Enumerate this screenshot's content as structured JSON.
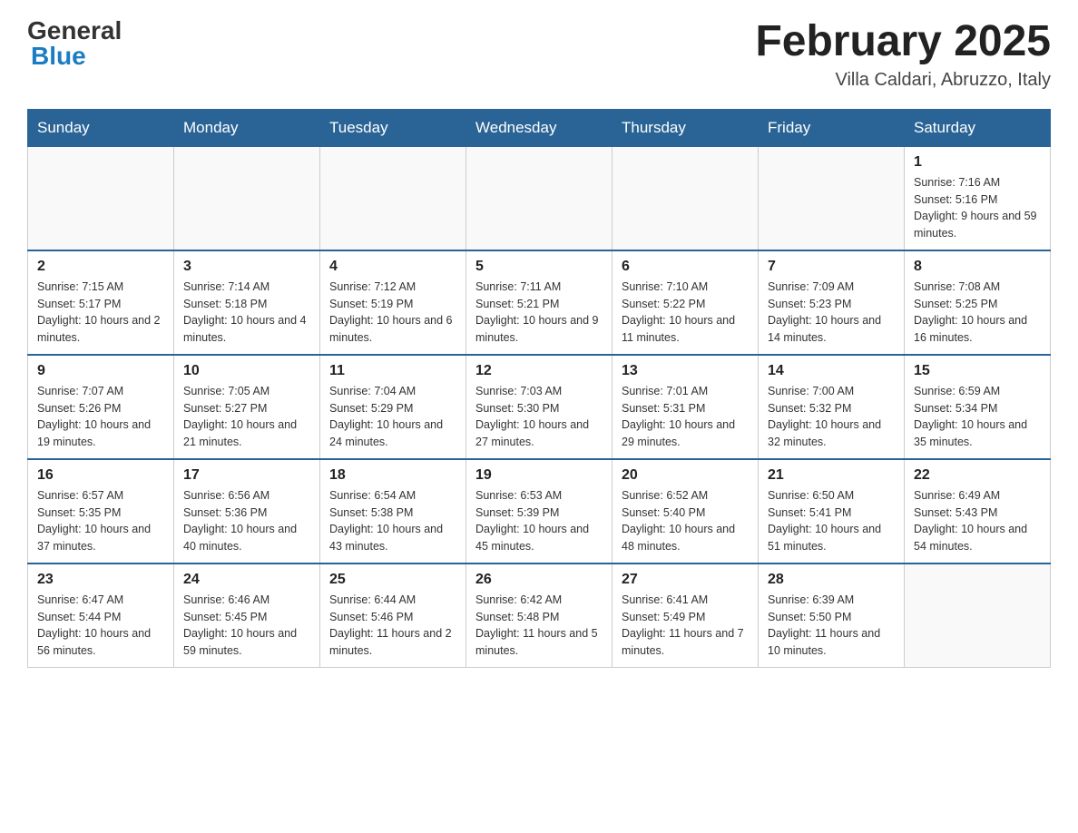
{
  "logo": {
    "general": "General",
    "blue": "Blue"
  },
  "title": "February 2025",
  "subtitle": "Villa Caldari, Abruzzo, Italy",
  "days_header": [
    "Sunday",
    "Monday",
    "Tuesday",
    "Wednesday",
    "Thursday",
    "Friday",
    "Saturday"
  ],
  "weeks": [
    [
      {
        "day": "",
        "info": ""
      },
      {
        "day": "",
        "info": ""
      },
      {
        "day": "",
        "info": ""
      },
      {
        "day": "",
        "info": ""
      },
      {
        "day": "",
        "info": ""
      },
      {
        "day": "",
        "info": ""
      },
      {
        "day": "1",
        "info": "Sunrise: 7:16 AM\nSunset: 5:16 PM\nDaylight: 9 hours and 59 minutes."
      }
    ],
    [
      {
        "day": "2",
        "info": "Sunrise: 7:15 AM\nSunset: 5:17 PM\nDaylight: 10 hours and 2 minutes."
      },
      {
        "day": "3",
        "info": "Sunrise: 7:14 AM\nSunset: 5:18 PM\nDaylight: 10 hours and 4 minutes."
      },
      {
        "day": "4",
        "info": "Sunrise: 7:12 AM\nSunset: 5:19 PM\nDaylight: 10 hours and 6 minutes."
      },
      {
        "day": "5",
        "info": "Sunrise: 7:11 AM\nSunset: 5:21 PM\nDaylight: 10 hours and 9 minutes."
      },
      {
        "day": "6",
        "info": "Sunrise: 7:10 AM\nSunset: 5:22 PM\nDaylight: 10 hours and 11 minutes."
      },
      {
        "day": "7",
        "info": "Sunrise: 7:09 AM\nSunset: 5:23 PM\nDaylight: 10 hours and 14 minutes."
      },
      {
        "day": "8",
        "info": "Sunrise: 7:08 AM\nSunset: 5:25 PM\nDaylight: 10 hours and 16 minutes."
      }
    ],
    [
      {
        "day": "9",
        "info": "Sunrise: 7:07 AM\nSunset: 5:26 PM\nDaylight: 10 hours and 19 minutes."
      },
      {
        "day": "10",
        "info": "Sunrise: 7:05 AM\nSunset: 5:27 PM\nDaylight: 10 hours and 21 minutes."
      },
      {
        "day": "11",
        "info": "Sunrise: 7:04 AM\nSunset: 5:29 PM\nDaylight: 10 hours and 24 minutes."
      },
      {
        "day": "12",
        "info": "Sunrise: 7:03 AM\nSunset: 5:30 PM\nDaylight: 10 hours and 27 minutes."
      },
      {
        "day": "13",
        "info": "Sunrise: 7:01 AM\nSunset: 5:31 PM\nDaylight: 10 hours and 29 minutes."
      },
      {
        "day": "14",
        "info": "Sunrise: 7:00 AM\nSunset: 5:32 PM\nDaylight: 10 hours and 32 minutes."
      },
      {
        "day": "15",
        "info": "Sunrise: 6:59 AM\nSunset: 5:34 PM\nDaylight: 10 hours and 35 minutes."
      }
    ],
    [
      {
        "day": "16",
        "info": "Sunrise: 6:57 AM\nSunset: 5:35 PM\nDaylight: 10 hours and 37 minutes."
      },
      {
        "day": "17",
        "info": "Sunrise: 6:56 AM\nSunset: 5:36 PM\nDaylight: 10 hours and 40 minutes."
      },
      {
        "day": "18",
        "info": "Sunrise: 6:54 AM\nSunset: 5:38 PM\nDaylight: 10 hours and 43 minutes."
      },
      {
        "day": "19",
        "info": "Sunrise: 6:53 AM\nSunset: 5:39 PM\nDaylight: 10 hours and 45 minutes."
      },
      {
        "day": "20",
        "info": "Sunrise: 6:52 AM\nSunset: 5:40 PM\nDaylight: 10 hours and 48 minutes."
      },
      {
        "day": "21",
        "info": "Sunrise: 6:50 AM\nSunset: 5:41 PM\nDaylight: 10 hours and 51 minutes."
      },
      {
        "day": "22",
        "info": "Sunrise: 6:49 AM\nSunset: 5:43 PM\nDaylight: 10 hours and 54 minutes."
      }
    ],
    [
      {
        "day": "23",
        "info": "Sunrise: 6:47 AM\nSunset: 5:44 PM\nDaylight: 10 hours and 56 minutes."
      },
      {
        "day": "24",
        "info": "Sunrise: 6:46 AM\nSunset: 5:45 PM\nDaylight: 10 hours and 59 minutes."
      },
      {
        "day": "25",
        "info": "Sunrise: 6:44 AM\nSunset: 5:46 PM\nDaylight: 11 hours and 2 minutes."
      },
      {
        "day": "26",
        "info": "Sunrise: 6:42 AM\nSunset: 5:48 PM\nDaylight: 11 hours and 5 minutes."
      },
      {
        "day": "27",
        "info": "Sunrise: 6:41 AM\nSunset: 5:49 PM\nDaylight: 11 hours and 7 minutes."
      },
      {
        "day": "28",
        "info": "Sunrise: 6:39 AM\nSunset: 5:50 PM\nDaylight: 11 hours and 10 minutes."
      },
      {
        "day": "",
        "info": ""
      }
    ]
  ]
}
